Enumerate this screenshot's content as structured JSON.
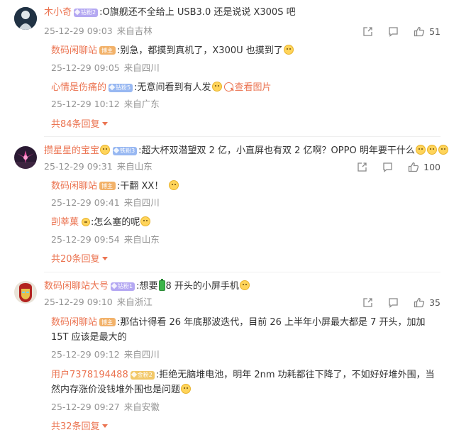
{
  "comments": [
    {
      "user": "木小奇",
      "badge": "钻粉2",
      "text": ":O旗舰还不全给上 USB3.0 还是说说 X300S 吧",
      "time": "25-12-29 09:03",
      "loc": "来自吉林",
      "likes": "51",
      "replies": [
        {
          "user": "数码闲聊站",
          "badge": "博主",
          "text": ":别急，都摸到真机了，X300U 也摸到了",
          "time": "25-12-29 09:05",
          "loc": "来自四川"
        },
        {
          "user": "心情是伤痛的",
          "badge": "钻粉5",
          "text": ":无意间看到有人发",
          "link": "查看图片",
          "time": "25-12-29 10:12",
          "loc": "来自广东"
        }
      ],
      "more": "共84条回复"
    },
    {
      "user": "攒星星的宝宝",
      "badge": "铁粉3",
      "text": ":超大杯双潜望双 2 亿，小直屏也有双 2 亿啊？OPPO 明年要干什么",
      "time": "25-12-29 09:31",
      "loc": "来自山东",
      "likes": "100",
      "replies": [
        {
          "user": "数码闲聊站",
          "badge": "博主",
          "text": ":干翻 XX！",
          "time": "25-12-29 09:41",
          "loc": "来自四川"
        },
        {
          "user": "剀莘菓",
          "badge": "",
          "text": ":怎么塞的呢",
          "time": "25-12-29 09:54",
          "loc": "来自山东"
        }
      ],
      "more": "共20条回复"
    },
    {
      "user": "数码闲聊站大号",
      "badge": "钻粉1",
      "text_before": ":想要",
      "text_after": "8 开头的小屏手机",
      "time": "25-12-29 09:10",
      "loc": "来自浙江",
      "likes": "35",
      "replies": [
        {
          "user": "数码闲聊站",
          "badge": "博主",
          "text": ":那估计得看 26 年底那波迭代，目前 26 上半年小屏最大都是 7 开头，加加 15T 应该是最大的",
          "time": "25-12-29 09:12",
          "loc": "来自四川"
        },
        {
          "user": "用户7378194488",
          "badge": "金粉2",
          "text": ":拒绝无脑堆电池，明年 2nm 功耗都往下降了，不如好好堆外围，当然内存涨价没钱堆外围也是问题",
          "time": "25-12-29 09:27",
          "loc": "来自安徽"
        }
      ],
      "more": "共32条回复"
    }
  ],
  "icons": {
    "share": "share-icon",
    "comment": "comment-icon",
    "like": "thumbs-up-icon",
    "expand": "chevron-down-icon"
  },
  "colors": {
    "username": "#eb7350",
    "meta": "#939393",
    "text": "#333333"
  }
}
